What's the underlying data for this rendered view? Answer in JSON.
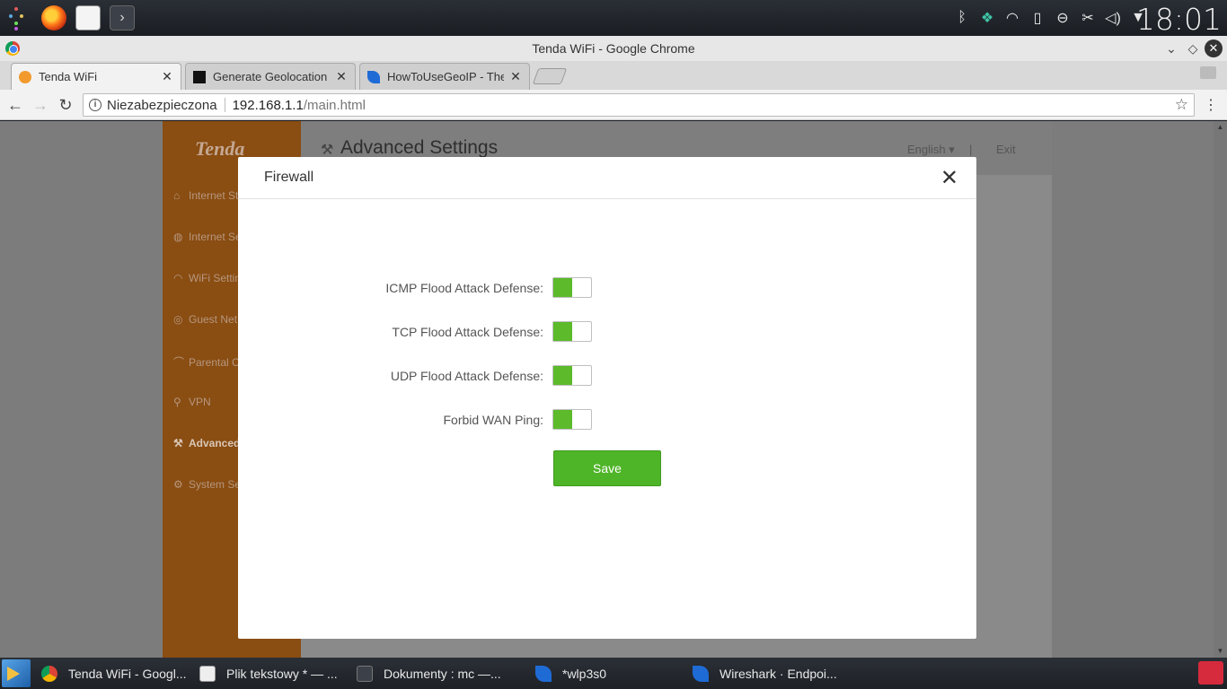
{
  "system_panel": {
    "clock": "18:01",
    "tray_icons": [
      "bluetooth-icon",
      "network-icon",
      "wifi-icon",
      "battery-icon",
      "usb-icon",
      "scissors-icon",
      "volume-icon",
      "arrow-down-icon"
    ]
  },
  "browser": {
    "window_title": "Tenda WiFi - Google Chrome",
    "tabs": [
      {
        "label": "Tenda WiFi",
        "active": true
      },
      {
        "label": "Generate Geolocation",
        "active": false
      },
      {
        "label": "HowToUseGeoIP - The",
        "active": false
      }
    ],
    "address": {
      "security_label": "Niezabezpieczona",
      "host": "192.168.1.1",
      "path": "/main.html"
    }
  },
  "router_page": {
    "brand": "Tenda",
    "title": "Advanced Settings",
    "language": "English",
    "lang_separator": "|",
    "exit": "Exit",
    "sidebar": [
      {
        "label": "Internet St"
      },
      {
        "label": "Internet Se"
      },
      {
        "label": "WiFi Settin"
      },
      {
        "label": "Guest Net"
      },
      {
        "label": "Parental C"
      },
      {
        "label": "VPN"
      },
      {
        "label": "Advanced",
        "active": true
      },
      {
        "label": "System Se"
      }
    ]
  },
  "modal": {
    "title": "Firewall",
    "close": "✕",
    "rows": [
      {
        "label": "ICMP Flood Attack Defense:",
        "enabled": true
      },
      {
        "label": "TCP Flood Attack Defense:",
        "enabled": true
      },
      {
        "label": "UDP Flood Attack Defense:",
        "enabled": true
      },
      {
        "label": "Forbid WAN Ping:",
        "enabled": true
      }
    ],
    "save_label": "Save"
  },
  "taskbar": {
    "tasks": [
      {
        "label": "Tenda WiFi - Googl..."
      },
      {
        "label": "Plik tekstowy * — ..."
      },
      {
        "label": "Dokumenty : mc —..."
      },
      {
        "label": "*wlp3s0"
      },
      {
        "label": "Wireshark · Endpoi..."
      }
    ]
  },
  "colors": {
    "accent_green": "#5cba2b",
    "sidebar_orange": "#8a4d12"
  }
}
